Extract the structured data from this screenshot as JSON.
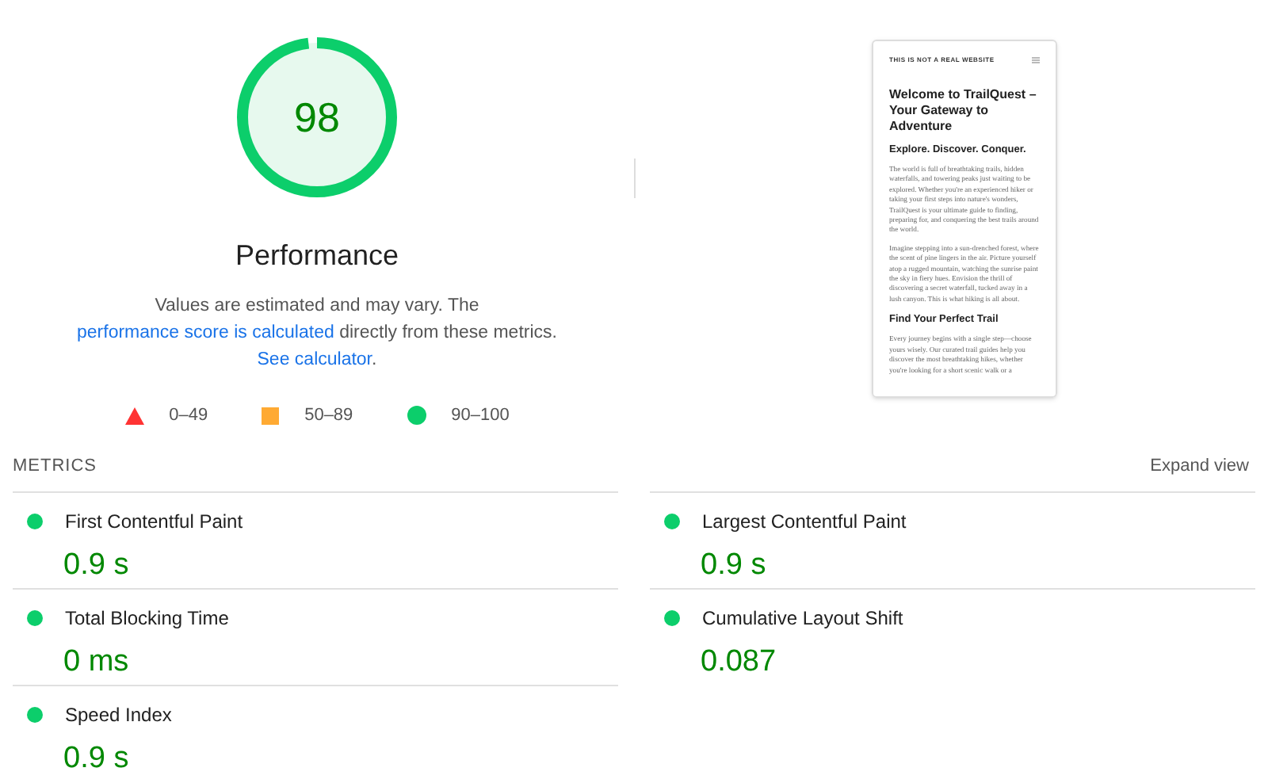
{
  "gauge": {
    "score": "98",
    "level": 0.98,
    "label": "Performance"
  },
  "description": [
    {
      "kind": "text",
      "text": "Values are estimated and may vary. The "
    },
    {
      "kind": "link",
      "text": "performance score is calculated"
    },
    {
      "kind": "text",
      "text": " directly from these metrics. "
    },
    {
      "kind": "link",
      "text": "See calculator"
    },
    {
      "kind": "text",
      "text": "."
    }
  ],
  "legend": [
    {
      "kind": "triangle",
      "color": "#ff3333",
      "range": "0–49"
    },
    {
      "kind": "square",
      "color": "#ffaa33",
      "range": "50–89"
    },
    {
      "kind": "circle",
      "color": "#0cce6b",
      "range": "90–100"
    }
  ],
  "preview": {
    "site_label": "THIS IS NOT A REAL WEBSITE",
    "blocks": [
      {
        "kind": "heading",
        "text": "Welcome to TrailQuest – Your Gateway to Adventure"
      },
      {
        "kind": "subheading",
        "text": "Explore. Discover. Conquer."
      },
      {
        "kind": "paragraph",
        "text": "The world is full of breathtaking trails, hidden waterfalls, and towering peaks just waiting to be explored. Whether you're an experienced hiker or taking your first steps into nature's wonders, TrailQuest is your ultimate guide to finding, preparing for, and conquering the best trails around the world."
      },
      {
        "kind": "paragraph",
        "text": "Imagine stepping into a sun-drenched forest, where the scent of pine lingers in the air. Picture yourself atop a rugged mountain, watching the sunrise paint the sky in fiery hues. Envision the thrill of discovering a secret waterfall, tucked away in a lush canyon. This is what hiking is all about."
      },
      {
        "kind": "subheading",
        "text": "Find Your Perfect Trail"
      },
      {
        "kind": "paragraph",
        "text": "Every journey begins with a single step—choose yours wisely. Our curated trail guides help you discover the most breathtaking hikes, whether you're looking for a short scenic walk or a"
      }
    ]
  },
  "metrics": {
    "title": "METRICS",
    "expand": "Expand view",
    "items": [
      {
        "name": "First Contentful Paint",
        "value": "0.9 s",
        "color": "#0cce6b"
      },
      {
        "name": "Largest Contentful Paint",
        "value": "0.9 s",
        "color": "#0cce6b"
      },
      {
        "name": "Total Blocking Time",
        "value": "0 ms",
        "color": "#0cce6b"
      },
      {
        "name": "Cumulative Layout Shift",
        "value": "0.087",
        "color": "#0cce6b"
      },
      {
        "name": "Speed Index",
        "value": "0.9 s",
        "color": "#0cce6b"
      }
    ]
  }
}
